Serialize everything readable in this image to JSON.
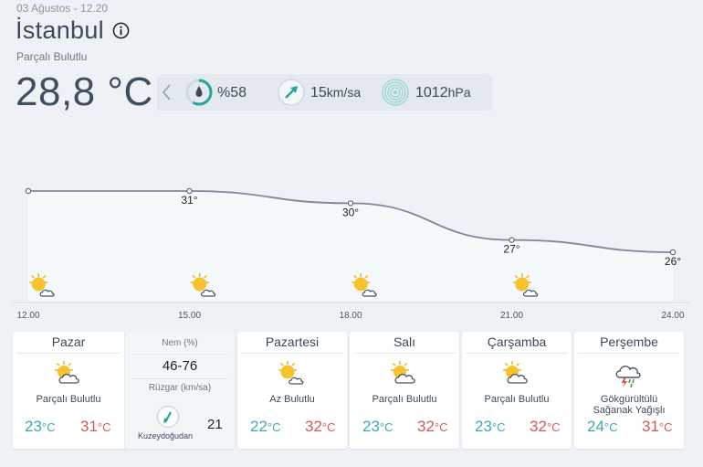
{
  "header": {
    "date": "03 Ağustos - 12.20",
    "city": "İstanbul",
    "condition": "Parçalı Bulutlu",
    "temperature": "28,8 °C"
  },
  "stats": {
    "humidity": "%58",
    "humidity_level": 0.58,
    "wind_value": "15",
    "wind_unit": "km/sa",
    "pressure_value": "1012",
    "pressure_unit": "hPa"
  },
  "chart_data": {
    "type": "line",
    "x": [
      "12.00",
      "15.00",
      "18.00",
      "21.00",
      "24.00"
    ],
    "series": [
      {
        "values": [
          31,
          31,
          30,
          27,
          26
        ]
      }
    ],
    "point_labels": [
      "",
      "31°",
      "30°",
      "27°",
      "26°"
    ],
    "icons": [
      "partly-cloudy-icon",
      "partly-cloudy-icon",
      "partly-cloudy-icon",
      "partly-cloudy-icon"
    ]
  },
  "today": {
    "day": "Pazar",
    "desc": "Parçalı Bulutlu",
    "low": "23",
    "high": "31",
    "deg_unit": "°C",
    "humidity_label": "Nem (%)",
    "humidity_value": "46-76",
    "wind_label": "Rüzgar (km/sa)",
    "wind_dir": "Kuzeydoğudan",
    "wind_speed": "21"
  },
  "forecast": [
    {
      "day": "Pazartesi",
      "desc": "Az Bulutlu",
      "low": "22",
      "high": "32",
      "icon": "mostly-sunny-icon"
    },
    {
      "day": "Salı",
      "desc": "Parçalı Bulutlu",
      "low": "23",
      "high": "32",
      "icon": "partly-cloudy-icon"
    },
    {
      "day": "Çarşamba",
      "desc": "Parçalı Bulutlu",
      "low": "23",
      "high": "32",
      "icon": "partly-cloudy-icon"
    },
    {
      "day": "Perşembe",
      "desc": "Gökgürültülü Sağanak Yağışlı",
      "low": "24",
      "high": "31",
      "icon": "thunderstorm-icon"
    }
  ],
  "colors": {
    "low_temp": "#3fa7b4",
    "high_temp": "#d25a5a",
    "accent": "#2aa39a"
  }
}
